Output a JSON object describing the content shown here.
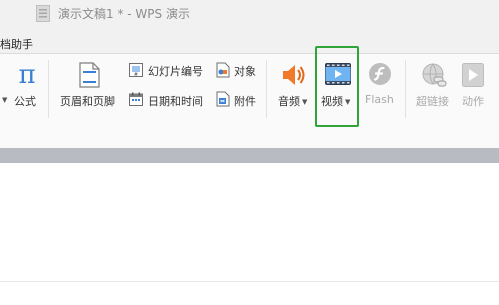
{
  "window": {
    "title": "演示文稿1 * - WPS 演示"
  },
  "menubar": {
    "item": "档助手"
  },
  "ribbon": {
    "formula": {
      "label": "公式",
      "icon": "pi-icon"
    },
    "header_footer": {
      "label": "页眉和页脚",
      "icon": "page-icon"
    },
    "slide_number": {
      "label": "幻灯片编号",
      "icon": "slide-number-icon"
    },
    "object": {
      "label": "对象",
      "icon": "object-icon"
    },
    "date_time": {
      "label": "日期和时间",
      "icon": "calendar-icon"
    },
    "attachment": {
      "label": "附件",
      "icon": "attachment-icon"
    },
    "audio": {
      "label": "音频",
      "icon": "speaker-icon"
    },
    "video": {
      "label": "视频",
      "icon": "film-icon"
    },
    "flash": {
      "label": "Flash",
      "icon": "flash-icon",
      "disabled": true
    },
    "hyperlink": {
      "label": "超链接",
      "icon": "globe-link-icon",
      "disabled": true
    },
    "animation": {
      "label": "动作",
      "icon": "play-icon",
      "disabled": true
    }
  },
  "colors": {
    "highlight": "#2ea43a",
    "accent_blue": "#3b7fd4",
    "audio_orange": "#f07a2a",
    "disabled": "#a9a9a9"
  }
}
